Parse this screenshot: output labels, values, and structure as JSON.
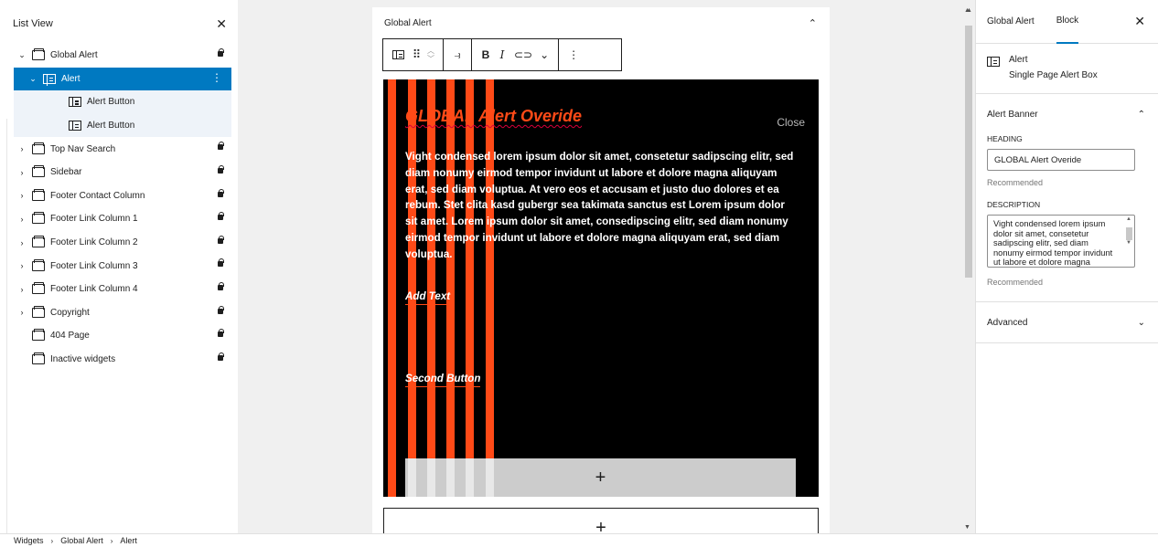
{
  "list_view": {
    "title": "List View",
    "items": [
      {
        "label": "Global Alert",
        "chevron": "v",
        "locked": true
      },
      {
        "label": "Alert",
        "chevron": "v",
        "selected": true
      },
      {
        "label": "Alert Button"
      },
      {
        "label": "Alert Button"
      },
      {
        "label": "Top Nav Search",
        "chevron": ">",
        "locked": true
      },
      {
        "label": "Sidebar",
        "chevron": ">",
        "locked": true
      },
      {
        "label": "Footer Contact Column",
        "chevron": ">",
        "locked": true
      },
      {
        "label": "Footer Link Column 1",
        "chevron": ">",
        "locked": true
      },
      {
        "label": "Footer Link Column 2",
        "chevron": ">",
        "locked": true
      },
      {
        "label": "Footer Link Column 3",
        "chevron": ">",
        "locked": true
      },
      {
        "label": "Footer Link Column 4",
        "chevron": ">",
        "locked": true
      },
      {
        "label": "Copyright",
        "chevron": ">",
        "locked": true
      },
      {
        "label": "404 Page",
        "locked": true
      },
      {
        "label": "Inactive widgets",
        "locked": true
      }
    ]
  },
  "canvas": {
    "area_title": "Global Alert",
    "alert": {
      "heading": "GLOBAL Alert Overide",
      "close_label": "Close",
      "description": "Vight condensed lorem ipsum dolor sit amet, consetetur sadipscing elitr, sed diam nonumy eirmod tempor invidunt ut labore et dolore magna aliquyam erat, sed diam voluptua. At vero eos et accusam et justo duo dolores et ea rebum. Stet clita kasd gubergr sea takimata sanctus est Lorem ipsum dolor sit amet. Lorem ipsum dolor sit amet, consedipscing elitr, sed diam nonumy eirmod tempor invidunt ut labore et dolore magna aliquyam erat, sed diam voluptua.",
      "button_1": "Add Text",
      "button_2": "Second Button",
      "add_symbol": "+"
    },
    "appender_symbol": "+"
  },
  "toolbar": {
    "bold": "B",
    "italic": "I"
  },
  "sidebar": {
    "tabs": [
      "Global Alert",
      "Block"
    ],
    "active_tab": "Block",
    "block_card": {
      "title": "Alert",
      "description": "Single Page Alert Box"
    },
    "alert_banner": {
      "title": "Alert Banner",
      "heading_label": "HEADING",
      "heading_value": "GLOBAL Alert Overide",
      "heading_help": "Recommended",
      "description_label": "DESCRIPTION",
      "description_value": "Vight condensed lorem ipsum dolor sit amet, consetetur sadipscing elitr, sed diam nonumy eirmod tempor invidunt ut labore et dolore magna aliquyam erat, sed diam voluptua.",
      "description_help": "Recommended"
    },
    "advanced": {
      "title": "Advanced"
    }
  },
  "breadcrumb": [
    "Widgets",
    "Global Alert",
    "Alert"
  ],
  "colors": {
    "accent": "#0079c1",
    "alert_bg": "#000000",
    "alert_orange": "#ff4a17",
    "canvas_bg": "#f0f0f0"
  },
  "icons": {
    "widget_area": "folder-icon",
    "block": "alert-block-icon",
    "lock": "lock-icon"
  }
}
